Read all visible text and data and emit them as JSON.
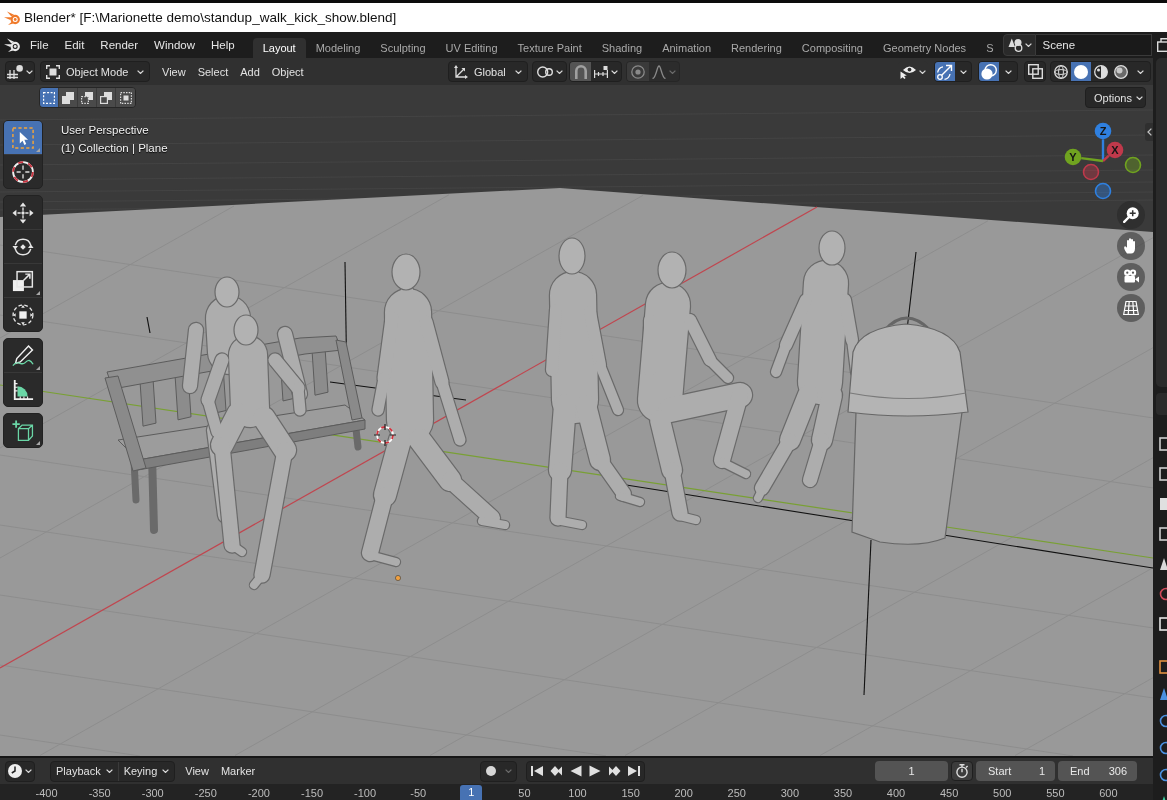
{
  "window": {
    "title": "Blender* [F:\\Marionette demo\\standup_walk_kick_show.blend]"
  },
  "menu_bar": {
    "menus": [
      "File",
      "Edit",
      "Render",
      "Window",
      "Help"
    ],
    "workspaces": [
      {
        "label": "Layout",
        "selected": true
      },
      {
        "label": "Modeling",
        "selected": false
      },
      {
        "label": "Sculpting",
        "selected": false
      },
      {
        "label": "UV Editing",
        "selected": false
      },
      {
        "label": "Texture Paint",
        "selected": false
      },
      {
        "label": "Shading",
        "selected": false
      },
      {
        "label": "Animation",
        "selected": false
      },
      {
        "label": "Rendering",
        "selected": false
      },
      {
        "label": "Compositing",
        "selected": false
      },
      {
        "label": "Geometry Nodes",
        "selected": false
      },
      {
        "label": "S",
        "selected": false
      }
    ],
    "scene": "Scene"
  },
  "viewport_header": {
    "mode": "Object Mode",
    "menus": [
      "View",
      "Select",
      "Add",
      "Object"
    ],
    "orientation": "Global",
    "snap": {
      "on": false
    },
    "proportional_editing": {
      "on": false
    },
    "gizmos": {
      "on": true
    },
    "overlays": {
      "on": true
    },
    "xray": {
      "on": false
    },
    "shading_modes": [
      {
        "selected": false
      },
      {
        "selected": true
      },
      {
        "selected": false
      },
      {
        "selected": false
      }
    ],
    "selection_modes": [
      {
        "selected": true
      },
      {
        "selected": false
      },
      {
        "selected": false
      },
      {
        "selected": false
      },
      {
        "selected": false
      }
    ],
    "options": "Options"
  },
  "viewport": {
    "view_name": "User Perspective",
    "object_info": "(1) Collection | Plane"
  },
  "toolbar": [
    {
      "tools": [
        {
          "selected": true
        },
        {
          "selected": false
        }
      ]
    },
    {
      "tools": [
        {
          "selected": false
        },
        {
          "selected": false
        },
        {
          "selected": false
        },
        {
          "selected": false
        }
      ]
    },
    {
      "tools": [
        {
          "selected": false
        },
        {
          "selected": false
        }
      ]
    },
    {
      "tools": [
        {
          "selected": false
        }
      ]
    }
  ],
  "navigation_gizmo": {
    "axes": [
      {
        "label": "Z",
        "color": "#2f80e0"
      },
      {
        "label": "X",
        "color": "#c0394b"
      },
      {
        "label": "Y",
        "color": "#70a320"
      }
    ]
  },
  "timeline": {
    "dropdowns": [
      "Playback",
      "Keying"
    ],
    "menus": [
      "View",
      "Marker"
    ],
    "current_frame": "1",
    "start": {
      "label": "Start",
      "value": "1"
    },
    "end": {
      "label": "End",
      "value": "306"
    },
    "ruler": [
      {
        "label": "-400",
        "selected": false
      },
      {
        "label": "-350",
        "selected": false
      },
      {
        "label": "-300",
        "selected": false
      },
      {
        "label": "-250",
        "selected": false
      },
      {
        "label": "-200",
        "selected": false
      },
      {
        "label": "-150",
        "selected": false
      },
      {
        "label": "-100",
        "selected": false
      },
      {
        "label": "-50",
        "selected": false
      },
      {
        "label": "1",
        "selected": true
      },
      {
        "label": "50",
        "selected": false
      },
      {
        "label": "100",
        "selected": false
      },
      {
        "label": "150",
        "selected": false
      },
      {
        "label": "200",
        "selected": false
      },
      {
        "label": "250",
        "selected": false
      },
      {
        "label": "300",
        "selected": false
      },
      {
        "label": "350",
        "selected": false
      },
      {
        "label": "400",
        "selected": false
      },
      {
        "label": "450",
        "selected": false
      },
      {
        "label": "500",
        "selected": false
      },
      {
        "label": "550",
        "selected": false
      },
      {
        "label": "600",
        "selected": false
      }
    ]
  }
}
